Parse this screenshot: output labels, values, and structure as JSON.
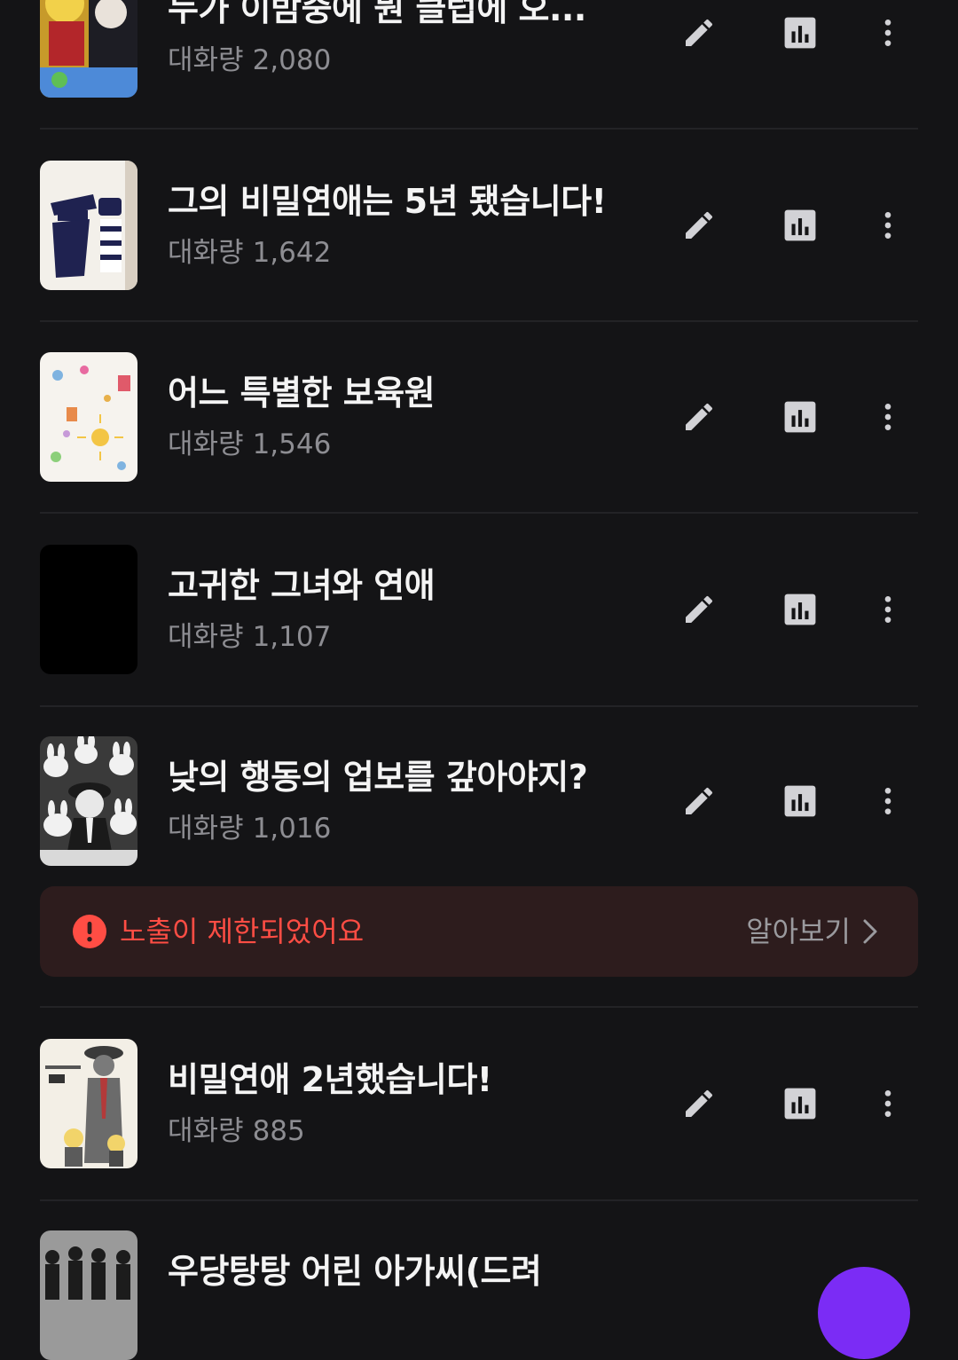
{
  "rows": [
    {
      "title": "누가 이밤중에 뭔 클럽에 오...",
      "count_label": "대화량",
      "count": "2,080"
    },
    {
      "title": "그의 비밀연애는 5년 됐습니다!",
      "count_label": "대화량",
      "count": "1,642"
    },
    {
      "title": "어느 특별한 보육원",
      "count_label": "대화량",
      "count": "1,546"
    },
    {
      "title": "고귀한 그녀와 연애",
      "count_label": "대화량",
      "count": "1,107"
    },
    {
      "title": "낮의 행동의 업보를 갚아야지?",
      "count_label": "대화량",
      "count": "1,016"
    },
    {
      "title": "비밀연애 2년했습니다!",
      "count_label": "대화량",
      "count": "885"
    },
    {
      "title": "우당탕탕 어린 아가씨(드려",
      "count_label": "",
      "count": ""
    }
  ],
  "notice": {
    "text": "노출이 제한되었어요",
    "link_label": "알아보기",
    "icon": "exclamation-circle-icon"
  },
  "row_actions": {
    "edit_icon": "pencil-icon",
    "stats_icon": "bar-chart-icon",
    "more_icon": "more-vertical-icon"
  },
  "colors": {
    "background": "#141416",
    "title": "#f4f4f4",
    "meta": "#8d8d92",
    "notice_background": "#2d1c1d",
    "notice_text": "#ff4d44",
    "accent_fab": "#7b2cf5"
  }
}
